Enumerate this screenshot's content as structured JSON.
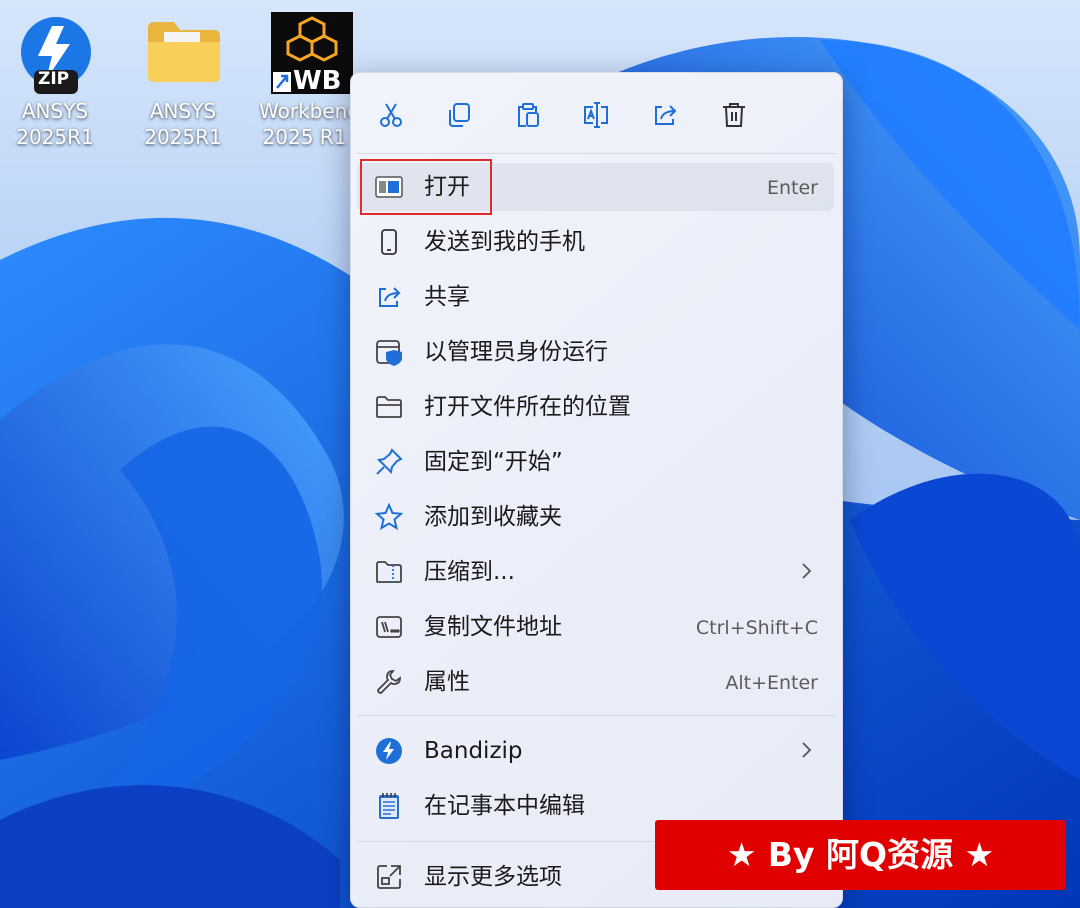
{
  "desktop": {
    "icons": [
      {
        "name": "zip-archive",
        "label_line1": "ANSYS",
        "label_line2": "2025R1",
        "badge": "ZIP"
      },
      {
        "name": "folder",
        "label_line1": "ANSYS",
        "label_line2": "2025R1"
      },
      {
        "name": "workbench-shortcut",
        "label_line1": "Workbench",
        "label_line2": "2025 R1",
        "badge": "WB"
      }
    ]
  },
  "menu": {
    "toolbar": [
      {
        "icon": "cut-icon",
        "tooltip": "剪切"
      },
      {
        "icon": "copy-icon",
        "tooltip": "复制"
      },
      {
        "icon": "paste-icon",
        "tooltip": "粘贴"
      },
      {
        "icon": "rename-icon",
        "tooltip": "重命名"
      },
      {
        "icon": "share-icon",
        "tooltip": "共享"
      },
      {
        "icon": "delete-icon",
        "tooltip": "删除"
      }
    ],
    "items": [
      {
        "label": "打开",
        "shortcut": "Enter",
        "icon": "open-icon"
      },
      {
        "label": "发送到我的手机",
        "icon": "phone-icon"
      },
      {
        "label": "共享",
        "icon": "share-icon"
      },
      {
        "label": "以管理员身份运行",
        "icon": "admin-shield-icon"
      },
      {
        "label": "打开文件所在的位置",
        "icon": "folder-open-icon"
      },
      {
        "label": "固定到“开始”",
        "icon": "pin-icon"
      },
      {
        "label": "添加到收藏夹",
        "icon": "star-icon"
      },
      {
        "label": "压缩到...",
        "icon": "zip-folder-icon",
        "submenu": true
      },
      {
        "label": "复制文件地址",
        "shortcut": "Ctrl+Shift+C",
        "icon": "copy-path-icon"
      },
      {
        "label": "属性",
        "shortcut": "Alt+Enter",
        "icon": "wrench-icon"
      },
      {
        "label": "Bandizip",
        "icon": "bandizip-icon",
        "submenu": true
      },
      {
        "label": "在记事本中编辑",
        "icon": "notepad-icon"
      },
      {
        "label": "显示更多选项",
        "icon": "more-options-icon"
      }
    ]
  },
  "watermark": {
    "text": "★ By 阿Q资源 ★"
  },
  "colors": {
    "accent": "#1f6fd8",
    "highlight_border": "#e02b2b",
    "watermark_bg": "#e00000"
  }
}
